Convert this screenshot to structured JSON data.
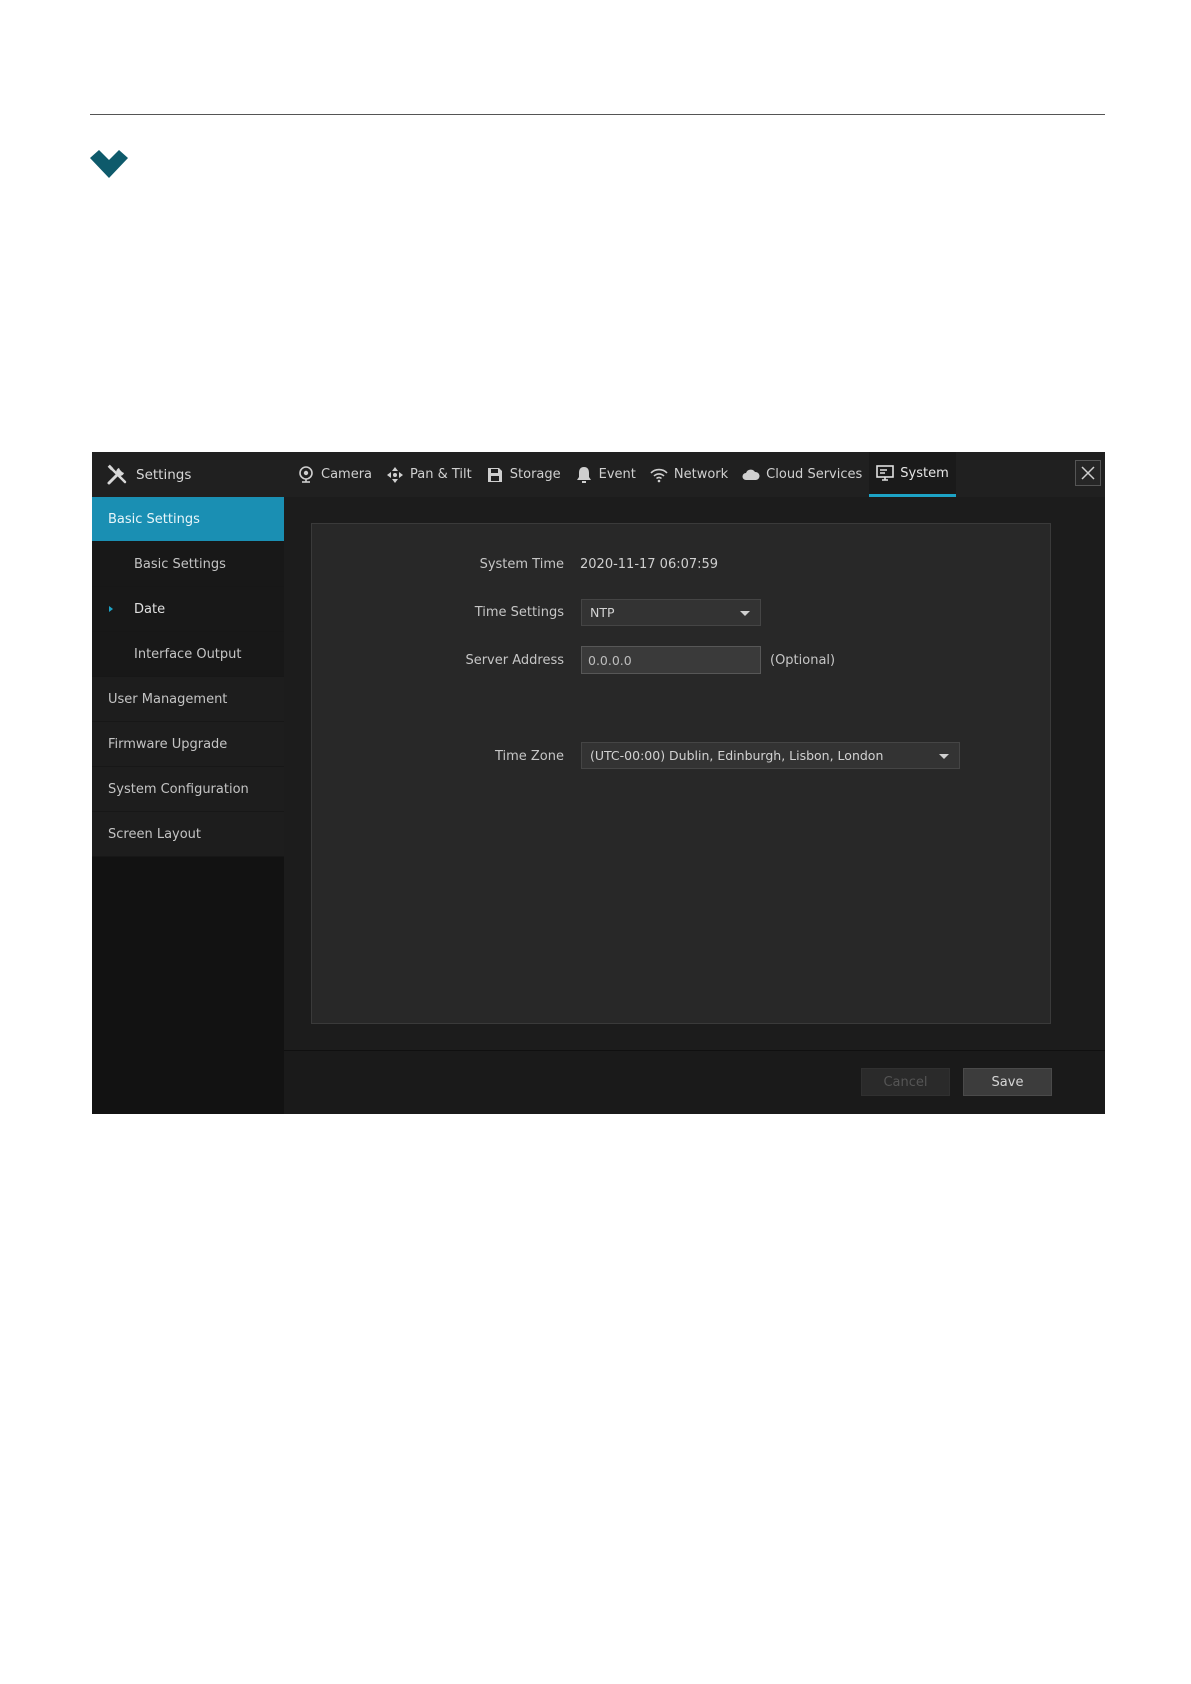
{
  "topbar": {
    "brand_label": "Settings",
    "tabs": [
      {
        "label": "Camera",
        "icon": "camera-icon"
      },
      {
        "label": "Pan & Tilt",
        "icon": "pan-tilt-icon"
      },
      {
        "label": "Storage",
        "icon": "storage-icon"
      },
      {
        "label": "Event",
        "icon": "bell-icon"
      },
      {
        "label": "Network",
        "icon": "wifi-icon"
      },
      {
        "label": "Cloud Services",
        "icon": "cloud-icon"
      },
      {
        "label": "System",
        "icon": "monitor-icon",
        "active": true
      }
    ]
  },
  "sidebar": {
    "items": [
      {
        "label": "Basic Settings",
        "type": "group",
        "active": true
      },
      {
        "label": "Basic Settings",
        "type": "sub"
      },
      {
        "label": "Date",
        "type": "sub",
        "current": true
      },
      {
        "label": "Interface Output",
        "type": "sub"
      },
      {
        "label": "User Management",
        "type": "group"
      },
      {
        "label": "Firmware Upgrade",
        "type": "group"
      },
      {
        "label": "System Configuration",
        "type": "group"
      },
      {
        "label": "Screen Layout",
        "type": "group"
      }
    ]
  },
  "form": {
    "system_time_label": "System Time",
    "system_time_value": "2020-11-17 06:07:59",
    "time_settings_label": "Time Settings",
    "time_settings_value": "NTP",
    "server_address_label": "Server Address",
    "server_address_value": "0.0.0.0",
    "server_address_hint": "(Optional)",
    "time_zone_label": "Time Zone",
    "time_zone_value": "(UTC-00:00) Dublin, Edinburgh, Lisbon, London"
  },
  "footer": {
    "cancel_label": "Cancel",
    "save_label": "Save"
  },
  "colors": {
    "accent": "#1da3c6",
    "sidebar_active": "#1a8fb3",
    "chevron": "#0e5a6b"
  }
}
